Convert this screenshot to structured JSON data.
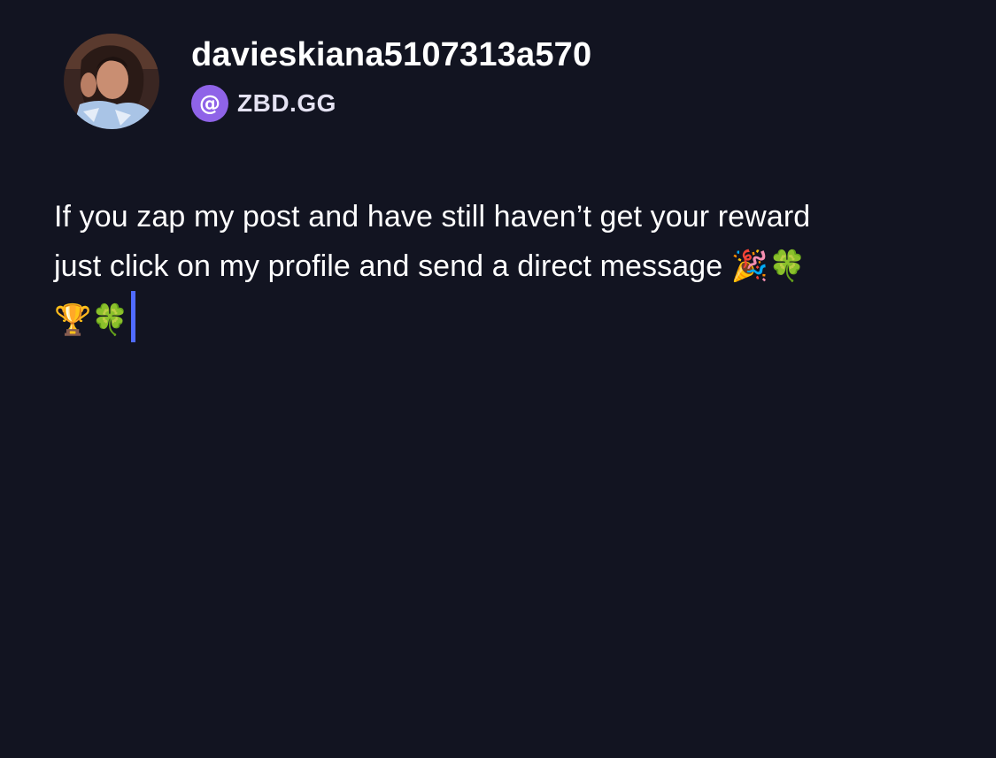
{
  "profile": {
    "username": "davieskiana5107313a570",
    "avatar_icon": "user-avatar-photo",
    "nip05_icon": "at-sign-icon",
    "nip05_symbol": "@",
    "nip05_domain": "ZBD.GG",
    "accent_color": "#8f63e8"
  },
  "post": {
    "line1": "If you zap my post and have still haven’t get your reward",
    "line2": "just click on my profile and send a direct message ",
    "emoji_line2": "🎉🍀",
    "emoji_line3": "🏆🍀",
    "caret_color": "#4f6bff"
  },
  "theme": {
    "background": "#121421",
    "text": "#ffffff"
  }
}
